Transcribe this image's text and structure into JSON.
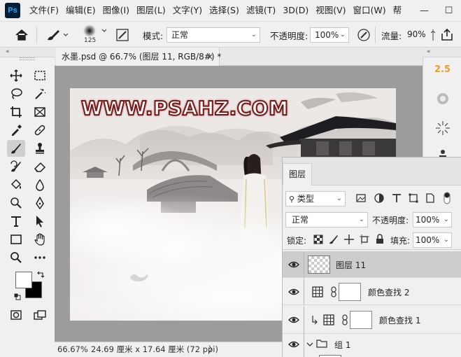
{
  "app": {
    "logo_text": "Ps"
  },
  "menu": [
    "文件(F)",
    "编辑(E)",
    "图像(I)",
    "图层(L)",
    "文字(Y)",
    "选择(S)",
    "滤镜(T)",
    "3D(D)",
    "视图(V)",
    "窗口(W)",
    "帮"
  ],
  "window_controls": {
    "minimize": "—",
    "maximize": "☐"
  },
  "options": {
    "brush_size": "125",
    "mode_label": "模式:",
    "mode_value": "正常",
    "opacity_label": "不透明度:",
    "opacity_value": "100%",
    "flow_label": "流量:",
    "flow_value": "90%"
  },
  "document": {
    "tab_title": "水墨.psd @ 66.7% (图层 11, RGB/8#) *",
    "close": "×",
    "watermark": "WWW.PSAHZ.COM"
  },
  "status": {
    "zoom": "66.67%",
    "doc_size": "24.69 厘米 x 17.64 厘米 (72 ppi)",
    "arrow": "〉"
  },
  "right_panel": {
    "value_2_5": "2.5"
  },
  "layers_panel": {
    "tab": "图层",
    "filter_value": "类型",
    "blend_mode": "正常",
    "opacity_label": "不透明度:",
    "opacity_value": "100%",
    "lock_label": "锁定:",
    "fill_label": "填充:",
    "fill_value": "100%",
    "layers": [
      {
        "name": "图层 11"
      },
      {
        "name": "颜色查找 2"
      },
      {
        "name": "颜色查找 1"
      },
      {
        "name": "组 1"
      }
    ]
  },
  "colors": {
    "accent_orange": "#e8a020",
    "selected_row": "#cdcdcd"
  },
  "icons": [
    "home-icon",
    "brush-icon",
    "brush-settings-icon",
    "airbrush-icon",
    "move-icon",
    "marquee-icon",
    "lasso-icon",
    "magic-wand-icon",
    "crop-icon",
    "frame-icon",
    "eyedropper-icon",
    "healing-icon",
    "brush-tool-icon",
    "stamp-icon",
    "history-brush-icon",
    "eraser-icon",
    "bucket-icon",
    "blur-icon",
    "dodge-icon",
    "pen-icon",
    "type-icon",
    "path-select-icon",
    "rectangle-icon",
    "hand-icon",
    "zoom-icon",
    "more-icon",
    "eye-icon",
    "lock-icon",
    "link-icon",
    "folder-icon"
  ]
}
